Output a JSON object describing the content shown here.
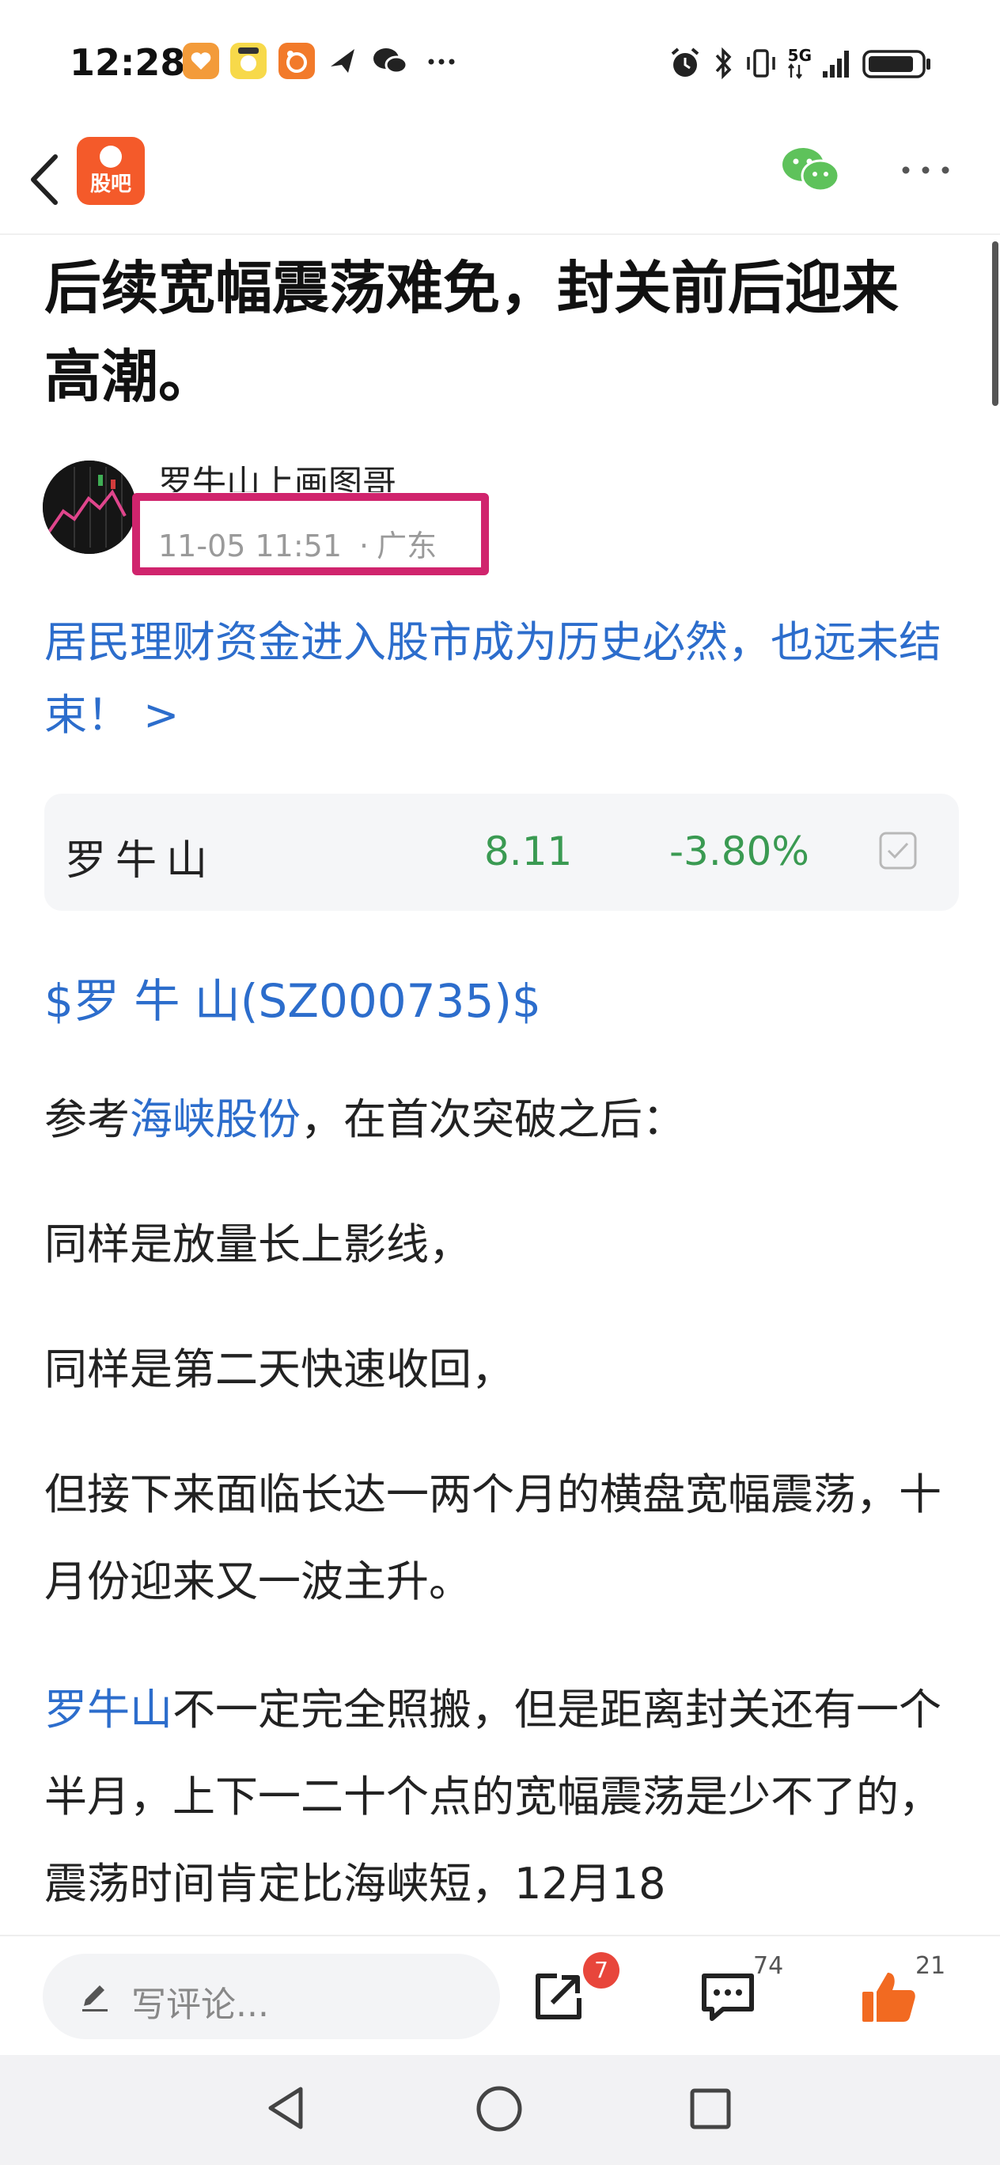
{
  "status_bar": {
    "time": "12:28",
    "network": "5G",
    "icons": [
      "heart-app-icon",
      "pet-app-icon",
      "meituan-app-icon",
      "feishu-icon",
      "wechat-icon",
      "more-dots-icon",
      "alarm-icon",
      "bluetooth-icon",
      "vibrate-icon",
      "signal-icon",
      "battery-icon"
    ]
  },
  "nav": {
    "logo_text": "股吧",
    "icons": [
      "back-icon",
      "wechat-share-icon",
      "more-icon"
    ]
  },
  "post": {
    "title": "后续宽幅震荡难免，封关前后迎来高潮。",
    "author": "罗牛山上画图哥",
    "date": "11-05 11:51",
    "location": "广东",
    "promo_link": "居民理财资金进入股市成为历史必然，也远未结束！ >"
  },
  "stock": {
    "name": "罗牛山",
    "price": "8.11",
    "change": "-3.80%",
    "tag": "$罗 牛 山(SZ000735)$",
    "color_down": "#3a9a52"
  },
  "body": {
    "p1_prefix": "参考",
    "p1_link": "海峡股份",
    "p1_suffix": "，在首次突破之后：",
    "p2": "同样是放量长上影线，",
    "p3": "同样是第二天快速收回，",
    "p4": "但接下来面临长达一两个月的横盘宽幅震荡，十月份迎来又一波主升。",
    "p5_link": "罗牛山",
    "p5_rest": "不一定完全照搬，但是距离封关还有一个半月，上下一二十个点的宽幅震荡是少不了的，震荡时间肯定比海峡短，12月18"
  },
  "actions": {
    "comment_placeholder": "写评论...",
    "share_badge": "7",
    "comment_count": "74",
    "like_count": "21"
  },
  "colors": {
    "accent_blue": "#2c6dcc",
    "logo_orange": "#f45a2a",
    "highlight_box": "#d0246d",
    "badge_red": "#e8463b",
    "like_orange": "#f26a21"
  }
}
